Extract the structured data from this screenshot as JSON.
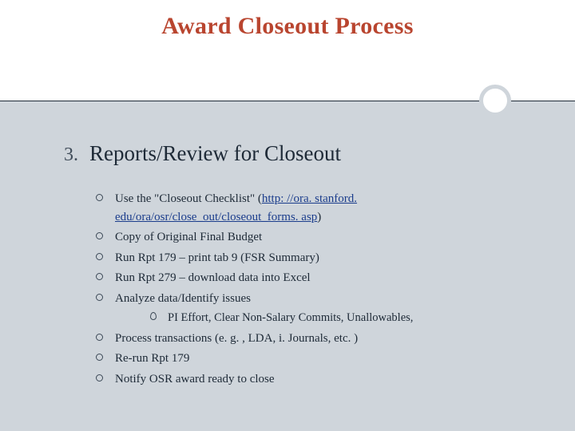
{
  "title": "Award Closeout Process",
  "section": {
    "number": "3.",
    "heading": "Reports/Review for Closeout"
  },
  "bullets": {
    "b1_pre": "Use the \"Closeout Checklist\" (",
    "b1_link": "http: //ora. stanford. edu/ora/osr/close_out/closeout_forms. asp",
    "b1_post": ")",
    "b2": "Copy of Original Final Budget",
    "b3": "Run Rpt 179 – print tab 9 (FSR Summary)",
    "b4": "Run Rpt 279 – download data into Excel",
    "b5": "Analyze data/Identify issues",
    "b5_sub1": "PI Effort, Clear Non-Salary Commits, Unallowables,",
    "b6": "Process transactions (e. g. , LDA, i. Journals, etc. )",
    "b7": "Re-run Rpt 179",
    "b8": "Notify OSR award ready to close"
  }
}
